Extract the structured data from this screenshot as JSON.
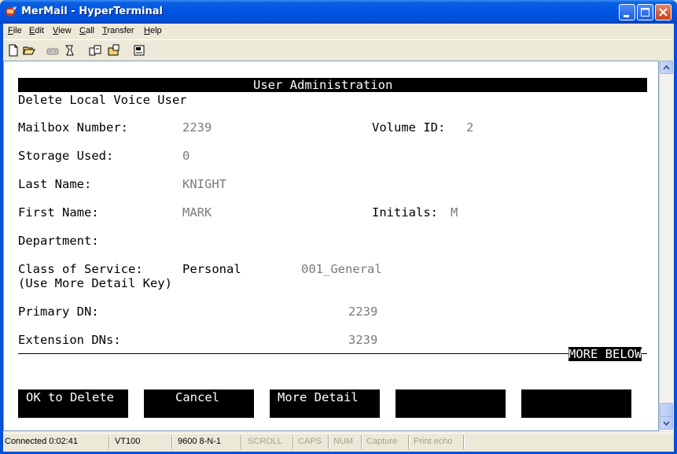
{
  "window": {
    "title": "MerMail - HyperTerminal"
  },
  "menu": [
    "File",
    "Edit",
    "View",
    "Call",
    "Transfer",
    "Help"
  ],
  "toolbar_icons": [
    "new-icon",
    "open-icon",
    "disconnect-icon",
    "call-icon",
    "send-icon",
    "receive-icon",
    "properties-icon"
  ],
  "terminal": {
    "header": "User Administration",
    "subtitle": "Delete Local Voice User",
    "fields": {
      "mailbox_label": "Mailbox Number:",
      "mailbox_value": "2239",
      "volume_label": "Volume ID:",
      "volume_value": "2",
      "storage_label": "Storage Used:",
      "storage_value": "0",
      "last_name_label": "Last Name:",
      "last_name_value": "KNIGHT",
      "first_name_label": "First Name:",
      "first_name_value": "MARK",
      "initials_label": "Initials:",
      "initials_value": "M",
      "department_label": "Department:",
      "cos_label": "Class of Service:",
      "cos_type": "Personal",
      "cos_value": "001_General",
      "cos_hint": "(Use More Detail Key)",
      "primary_dn_label": "Primary DN:",
      "primary_dn_value": "2239",
      "extension_dns_label": "Extension DNs:",
      "extension_dns_value": "3239"
    },
    "more_below": "MORE BELOW",
    "softkeys": [
      "OK to Delete",
      "Cancel",
      "More Detail",
      "",
      ""
    ]
  },
  "status": {
    "connected": "Connected 0:02:41",
    "emulation": "VT100",
    "settings": "9600 8-N-1",
    "scroll": "SCROLL",
    "caps": "CAPS",
    "num": "NUM",
    "capture": "Capture",
    "print_echo": "Print echo"
  }
}
